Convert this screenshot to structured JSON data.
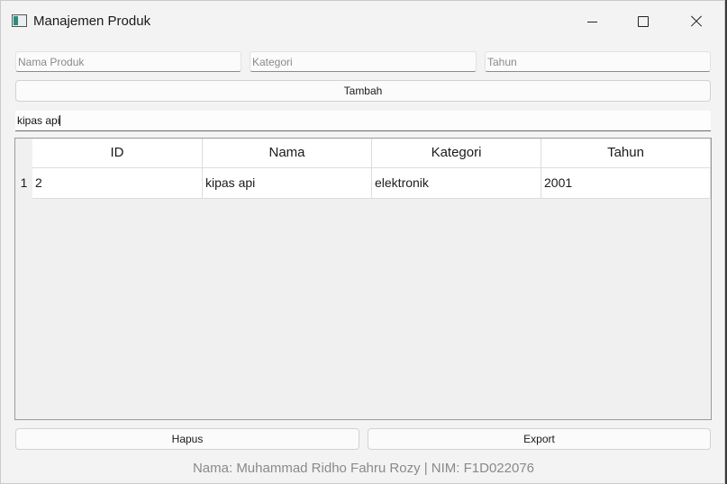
{
  "window": {
    "title": "Manajemen Produk"
  },
  "form": {
    "nama_placeholder": "Nama Produk",
    "kategori_placeholder": "Kategori",
    "tahun_placeholder": "Tahun",
    "add_label": "Tambah"
  },
  "search": {
    "value": "kipas api"
  },
  "table": {
    "columns": [
      "ID",
      "Nama",
      "Kategori",
      "Tahun"
    ],
    "rows": [
      {
        "row_number": "1",
        "cells": [
          "2",
          "kipas api",
          "elektronik",
          "2001"
        ]
      }
    ]
  },
  "actions": {
    "delete_label": "Hapus",
    "export_label": "Export"
  },
  "footer": {
    "text": "Nama: Muhammad Ridho Fahru Rozy | NIM: F1D022076"
  }
}
